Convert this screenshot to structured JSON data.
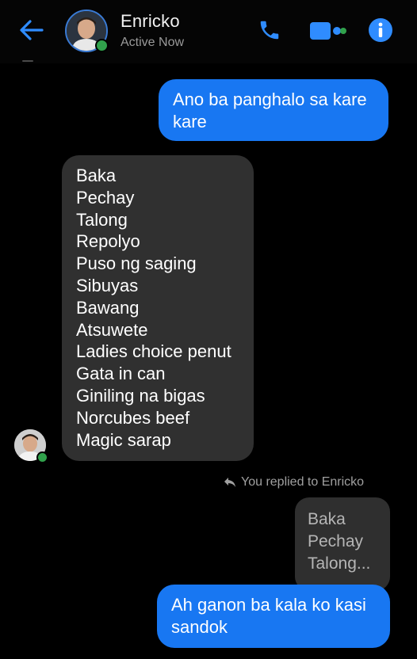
{
  "header": {
    "contact_name": "Enricko",
    "status": "Active Now",
    "icons": {
      "back": "back-arrow-icon",
      "call": "phone-icon",
      "video": "video-camera-icon",
      "info": "info-icon"
    },
    "accent_color": "#1877f2",
    "online_color": "#31a24c"
  },
  "messages": [
    {
      "direction": "sent",
      "text_lines": [
        "Ano ba panghalo sa kare",
        "kare"
      ]
    },
    {
      "direction": "received",
      "text_lines": [
        "Baka",
        "Pechay",
        "Talong",
        "Repolyo",
        "Puso ng saging",
        "Sibuyas",
        "Bawang",
        "Atsuwete",
        "Ladies choice penut",
        "Gata in can",
        "Giniling na bigas",
        "Norcubes beef",
        "Magic sarap"
      ]
    },
    {
      "direction": "reply_indicator",
      "text": "You replied to Enricko"
    },
    {
      "direction": "quoted",
      "text_lines": [
        "Baka",
        "Pechay",
        "Talong..."
      ]
    },
    {
      "direction": "sent",
      "text_lines": [
        "Ah ganon ba kala ko kasi",
        "sandok"
      ]
    }
  ],
  "colors": {
    "background": "#000000",
    "sent_bubble": "#1877f2",
    "received_bubble": "#303030"
  }
}
